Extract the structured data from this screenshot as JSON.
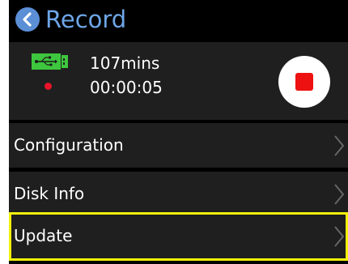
{
  "header": {
    "title": "Record",
    "back_icon": "back-chevron-icon",
    "back_color": "#5b8fd6",
    "title_color": "#6ea6e8"
  },
  "status": {
    "storage_icon": "usb-drive-icon",
    "storage_icon_color": "#3ec63e",
    "recording_indicator_color": "#e8142a",
    "capacity": "107mins",
    "elapsed": "00:00:05",
    "stop_icon": "stop-icon",
    "stop_color": "#ee1111"
  },
  "menu": {
    "items": [
      {
        "label": "Configuration",
        "icon": "chevron-right-icon"
      },
      {
        "label": "Disk Info",
        "icon": "chevron-right-icon"
      },
      {
        "label": "Update",
        "icon": "chevron-right-icon"
      }
    ],
    "selected_index": 2,
    "selection_color": "#f2f20c"
  }
}
